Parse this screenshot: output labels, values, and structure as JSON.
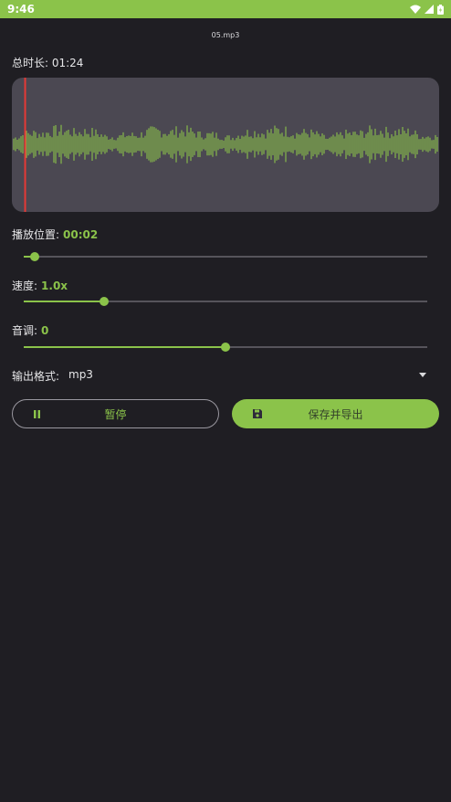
{
  "status_bar": {
    "time": "9:46",
    "icons": [
      "wifi-icon",
      "signal-icon",
      "battery-icon"
    ]
  },
  "file": {
    "name": "05.mp3"
  },
  "duration": {
    "label": "总时长: 01:24"
  },
  "colors": {
    "accent": "#8bc34a",
    "background": "#1f1e23",
    "waveform_bg": "#4b4852",
    "playhead": "#e53935"
  },
  "playback": {
    "label": "播放位置:",
    "value": "00:02",
    "fraction": 0.027
  },
  "speed": {
    "label": "速度:",
    "value": "1.0x",
    "fraction": 0.2
  },
  "pitch": {
    "label": "音调:",
    "value": "0",
    "fraction": 0.5
  },
  "format": {
    "label": "输出格式:",
    "selected": "mp3",
    "icon": "dropdown-caret-icon"
  },
  "buttons": {
    "pause_label": "暂停",
    "pause_icon": "pause-icon",
    "save_label": "保存并导出",
    "save_icon": "save-icon"
  }
}
